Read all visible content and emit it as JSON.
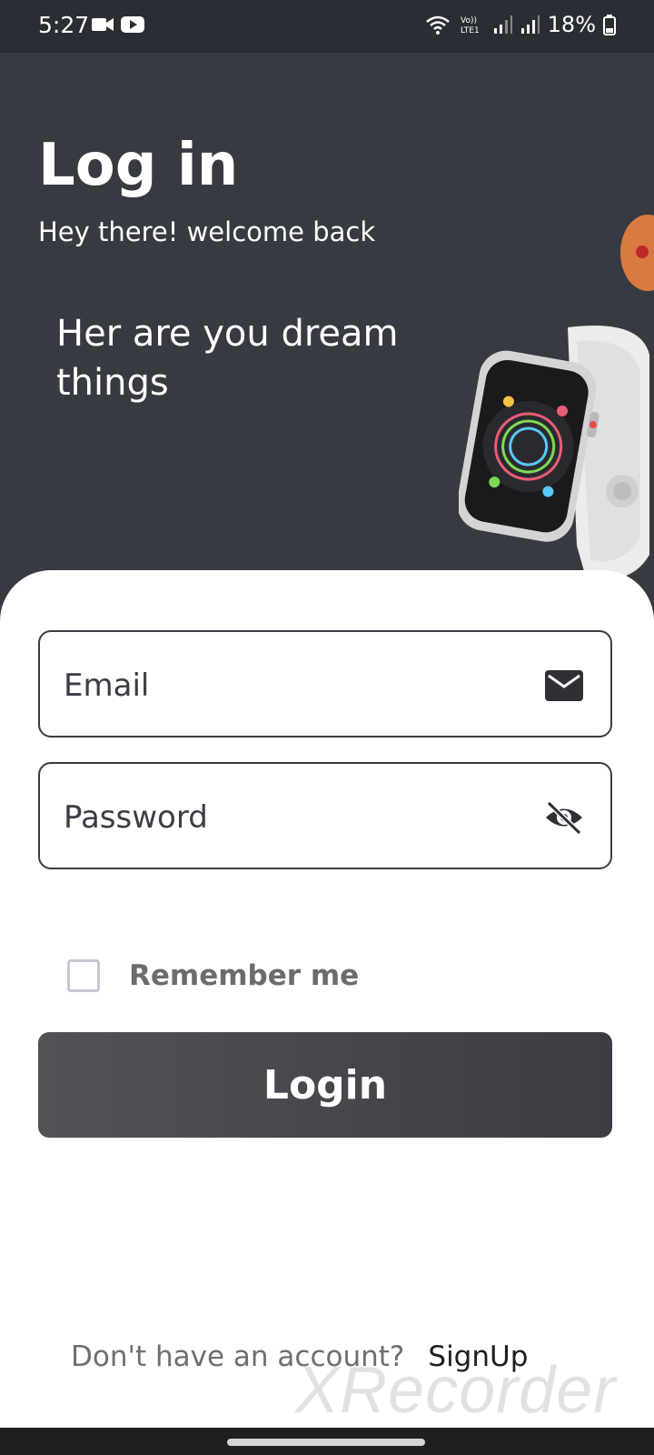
{
  "status_bar": {
    "time": "5:27",
    "battery": "18%",
    "icons_left": [
      "video-camera-icon",
      "youtube-icon"
    ],
    "icons_right": [
      "wifi-icon",
      "volte-icon",
      "signal-icon",
      "signal-icon",
      "battery-icon"
    ]
  },
  "header": {
    "title": "Log in",
    "subtitle": "Hey there! welcome back",
    "tagline": "Her are you dream things"
  },
  "form": {
    "email_placeholder": "Email",
    "password_placeholder": "Password",
    "email_icon": "mail-icon",
    "password_icon": "eye-off-icon",
    "remember_label": "Remember me",
    "remember_checked": false,
    "login_label": "Login"
  },
  "footer": {
    "question": "Don't have an account?",
    "signup_label": "SignUp"
  },
  "watermark": "XRecorder",
  "colors": {
    "background": "#373a41",
    "card": "#ffffff",
    "accent": "#3b3d43"
  }
}
